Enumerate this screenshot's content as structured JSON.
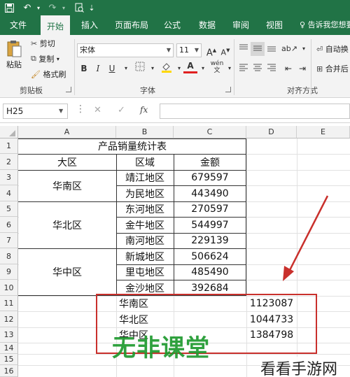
{
  "ribbon_tabs": [
    "文件",
    "开始",
    "插入",
    "页面布局",
    "公式",
    "数据",
    "审阅",
    "视图"
  ],
  "tell_me": "告诉我您想要",
  "clipboard": {
    "paste": "粘贴",
    "cut": "剪切",
    "copy": "复制",
    "format_painter": "格式刷",
    "group": "剪贴板"
  },
  "font": {
    "name": "宋体",
    "size": "11",
    "group": "字体",
    "bold": "B",
    "italic": "I",
    "underline": "U",
    "font_color_glyph": "A",
    "wen": "wén"
  },
  "alignment": {
    "wrap": "自动换",
    "merge": "合并后",
    "group": "对齐方式"
  },
  "formula_bar": {
    "name_box": "H25",
    "fx": "fx",
    "cancel": "✕",
    "enter": "✓"
  },
  "columns": [
    "A",
    "B",
    "C",
    "D",
    "E"
  ],
  "rows": [
    "1",
    "2",
    "3",
    "4",
    "5",
    "6",
    "7",
    "8",
    "9",
    "10",
    "11",
    "12",
    "13",
    "14",
    "15",
    "16"
  ],
  "table": {
    "title": "产品销量统计表",
    "headers": [
      "大区",
      "区域",
      "金额"
    ],
    "groups": [
      {
        "region": "华南区",
        "areas": [
          {
            "name": "靖江地区",
            "amount": "679597"
          },
          {
            "name": "为民地区",
            "amount": "443490"
          }
        ]
      },
      {
        "region": "华北区",
        "areas": [
          {
            "name": "东河地区",
            "amount": "270597"
          },
          {
            "name": "金牛地区",
            "amount": "544997"
          },
          {
            "name": "南河地区",
            "amount": "229139"
          }
        ]
      },
      {
        "region": "华中区",
        "areas": [
          {
            "name": "新城地区",
            "amount": "506624"
          },
          {
            "name": "里屯地区",
            "amount": "485490"
          },
          {
            "name": "金沙地区",
            "amount": "392684"
          }
        ]
      }
    ]
  },
  "summary": [
    {
      "region": "华南区",
      "total": "1123087"
    },
    {
      "region": "华北区",
      "total": "1044733"
    },
    {
      "region": "华中区",
      "total": "1384798"
    }
  ],
  "watermark": "无非课堂",
  "site_logo": "看看手游网",
  "colors": {
    "excel_green": "#217346",
    "annotation_red": "#c9302c",
    "watermark_green": "#1e9a2e"
  }
}
